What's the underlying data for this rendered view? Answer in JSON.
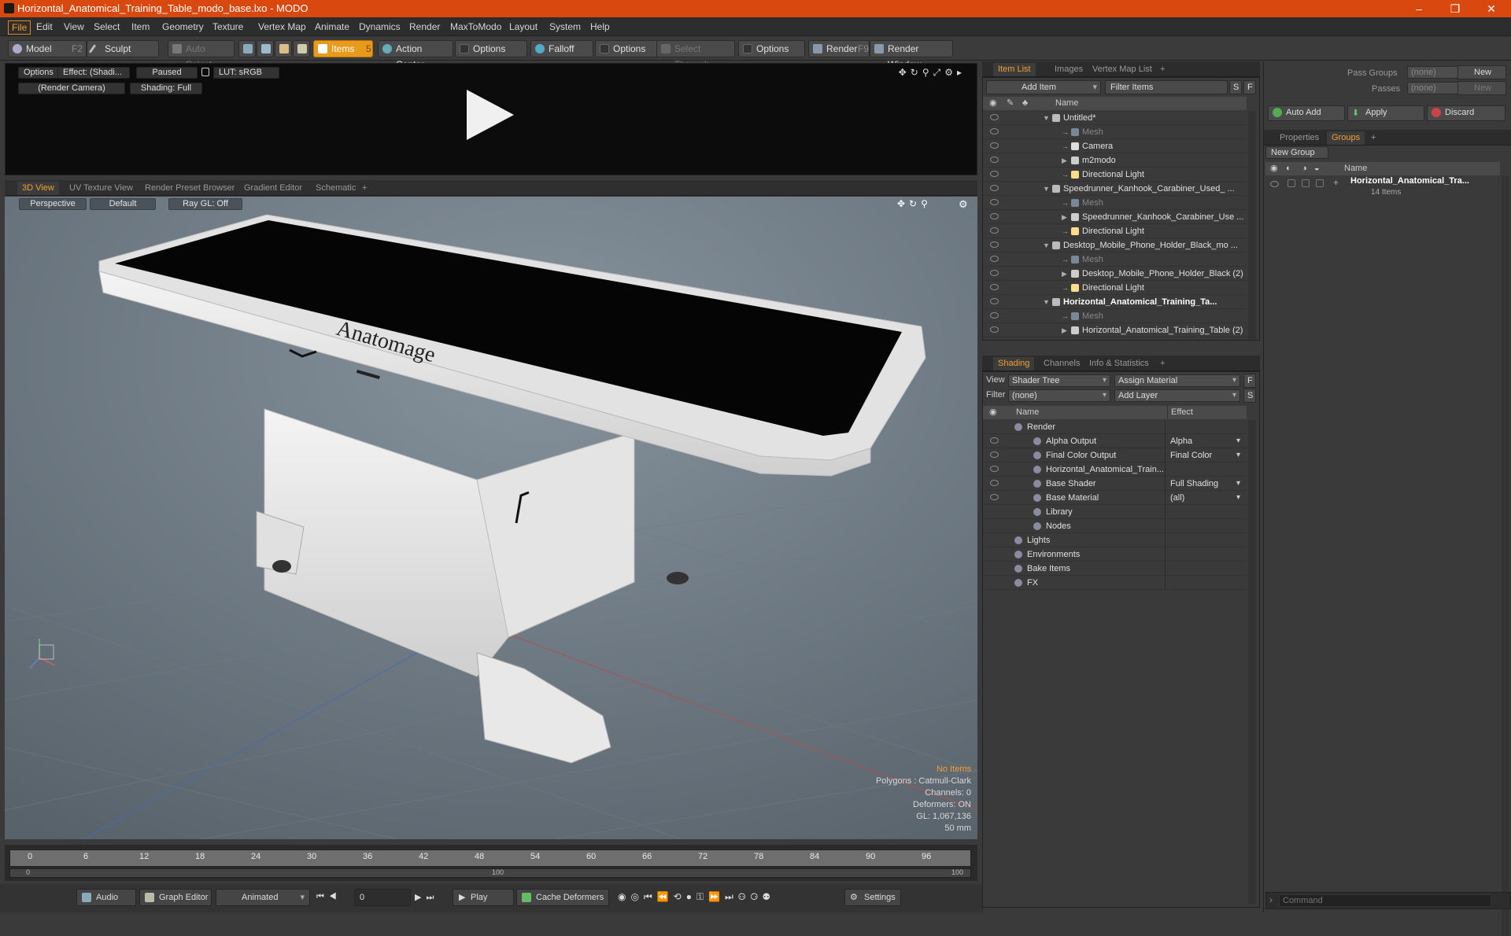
{
  "window": {
    "title": "Horizontal_Anatomical_Training_Table_modo_base.lxo - MODO",
    "min": "–",
    "max": "❐",
    "close": "✕"
  },
  "menu": [
    "File",
    "Edit",
    "View",
    "Select",
    "Item",
    "Geometry",
    "Texture",
    "Vertex Map",
    "Animate",
    "Dynamics",
    "Render",
    "MaxToModo",
    "Layout",
    "System",
    "Help"
  ],
  "toolbar": {
    "model": "Model",
    "model_key": "F2",
    "sculpt": "Sculpt",
    "auto_select": "Auto Select",
    "items": "Items",
    "items_key": "5",
    "action_center": "Action Center",
    "options1": "Options",
    "falloff": "Falloff",
    "options2": "Options",
    "select_through": "Select Through",
    "options3": "Options",
    "render": "Render",
    "render_key": "F9",
    "render_window": "Render Window"
  },
  "render_view": {
    "options": "Options",
    "effect": "Effect: (Shadi...",
    "paused": "Paused",
    "lut": "LUT: sRGB",
    "camera": "(Render Camera)",
    "shading": "Shading: Full"
  },
  "view_tabs": [
    "3D View",
    "UV Texture View",
    "Render Preset Browser",
    "Gradient Editor",
    "Schematic",
    "+"
  ],
  "viewport": {
    "perspective": "Perspective",
    "default": "Default",
    "raygl": "Ray GL: Off",
    "brand": "Anatomage"
  },
  "stats": {
    "items": "No Items",
    "polygons": "Polygons : Catmull-Clark",
    "channels": "Channels: 0",
    "deformers": "Deformers: ON",
    "gl": "GL: 1,067,136",
    "lens": "50 mm"
  },
  "timeline": {
    "ticks": [
      "0",
      "6",
      "12",
      "18",
      "24",
      "30",
      "36",
      "42",
      "48",
      "54",
      "60",
      "66",
      "72",
      "78",
      "84",
      "90",
      "96"
    ],
    "sub": [
      "0",
      "100",
      "100"
    ]
  },
  "bottom": {
    "audio": "Audio",
    "graph_editor": "Graph Editor",
    "animated": "Animated",
    "frame": "0",
    "play": "Play",
    "cache": "Cache Deformers",
    "settings": "Settings"
  },
  "item_list": {
    "tabs": [
      "Item List",
      "Images",
      "Vertex Map List",
      "+"
    ],
    "add_item": "Add Item",
    "filter_items": "Filter Items",
    "s": "S",
    "f": "F",
    "col_name": "Name",
    "rows": [
      {
        "label": "Untitled*",
        "indent": 0,
        "icon": "scene"
      },
      {
        "label": "Mesh",
        "indent": 1,
        "icon": "mesh",
        "dim": true
      },
      {
        "label": "Camera",
        "indent": 1,
        "icon": "camera"
      },
      {
        "label": "m2modo",
        "indent": 1,
        "icon": "group"
      },
      {
        "label": "Directional Light",
        "indent": 1,
        "icon": "light"
      },
      {
        "label": "Speedrunner_Kanhook_Carabiner_Used_ ...",
        "indent": 0,
        "icon": "scene"
      },
      {
        "label": "Mesh",
        "indent": 1,
        "icon": "mesh",
        "dim": true
      },
      {
        "label": "Speedrunner_Kanhook_Carabiner_Use ...",
        "indent": 1,
        "icon": "group"
      },
      {
        "label": "Directional Light",
        "indent": 1,
        "icon": "light"
      },
      {
        "label": "Desktop_Mobile_Phone_Holder_Black_mo ...",
        "indent": 0,
        "icon": "scene"
      },
      {
        "label": "Mesh",
        "indent": 1,
        "icon": "mesh",
        "dim": true
      },
      {
        "label": "Desktop_Mobile_Phone_Holder_Black (2)",
        "indent": 1,
        "icon": "group"
      },
      {
        "label": "Directional Light",
        "indent": 1,
        "icon": "light"
      },
      {
        "label": "Horizontal_Anatomical_Training_Ta...",
        "indent": 0,
        "icon": "scene",
        "bold": true
      },
      {
        "label": "Mesh",
        "indent": 1,
        "icon": "mesh",
        "dim": true
      },
      {
        "label": "Horizontal_Anatomical_Training_Table (2)",
        "indent": 1,
        "icon": "group"
      }
    ]
  },
  "shading": {
    "tabs": [
      "Shading",
      "Channels",
      "Info & Statistics",
      "+"
    ],
    "view_label": "View",
    "view_value": "Shader Tree",
    "assign": "Assign Material",
    "f": "F",
    "filter_label": "Filter",
    "filter_value": "(none)",
    "add_layer": "Add Layer",
    "s": "S",
    "col_name": "Name",
    "col_effect": "Effect",
    "rows": [
      {
        "label": "Render",
        "effect": "",
        "indent": 0,
        "eye": false
      },
      {
        "label": "Alpha Output",
        "effect": "Alpha",
        "indent": 1,
        "eye": true
      },
      {
        "label": "Final Color Output",
        "effect": "Final Color",
        "indent": 1,
        "eye": true
      },
      {
        "label": "Horizontal_Anatomical_Train...",
        "effect": "",
        "indent": 1,
        "eye": true
      },
      {
        "label": "Base Shader",
        "effect": "Full Shading",
        "indent": 1,
        "eye": true
      },
      {
        "label": "Base Material",
        "effect": "(all)",
        "indent": 1,
        "eye": true
      },
      {
        "label": "Library",
        "effect": "",
        "indent": 1,
        "eye": false
      },
      {
        "label": "Nodes",
        "effect": "",
        "indent": 1,
        "eye": false
      },
      {
        "label": "Lights",
        "effect": "",
        "indent": 0,
        "eye": false
      },
      {
        "label": "Environments",
        "effect": "",
        "indent": 0,
        "eye": false
      },
      {
        "label": "Bake Items",
        "effect": "",
        "indent": 0,
        "eye": false
      },
      {
        "label": "FX",
        "effect": "",
        "indent": 0,
        "eye": false
      }
    ]
  },
  "right": {
    "pass_groups": "Pass Groups",
    "pass_groups_val": "(none)",
    "new1": "New",
    "passes": "Passes",
    "passes_val": "(none)",
    "new2": "New",
    "auto_add": "Auto Add",
    "apply": "Apply",
    "discard": "Discard",
    "tabs": [
      "Properties",
      "Groups",
      "+"
    ],
    "new_group": "New Group",
    "col_name": "Name",
    "group_name": "Horizontal_Anatomical_Tra...",
    "group_count": "14 Items",
    "command": "Command"
  }
}
